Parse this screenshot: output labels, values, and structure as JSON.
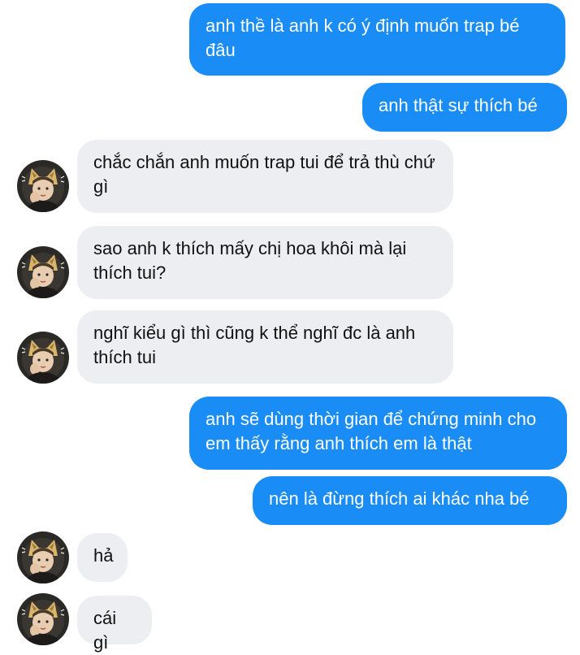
{
  "theme": {
    "outgoing_bubble": "#1a8cf5",
    "incoming_bubble": "#eceef1",
    "background": "#ffffff"
  },
  "avatar_icon": "user-photo-cat-ears-avatar",
  "messages": [
    {
      "sender": "me",
      "text": "anh thề là anh k có ý định muốn trap bé đâu"
    },
    {
      "sender": "me",
      "text": "anh thật sự thích bé"
    },
    {
      "sender": "them",
      "text": "chắc chắn anh muốn trap tui để trả thù chứ gì"
    },
    {
      "sender": "them",
      "text": "sao anh k thích mấy chị hoa khôi mà lại thích tui?"
    },
    {
      "sender": "them",
      "text": "nghĩ kiểu gì thì cũng k thể nghĩ đc là anh thích tui"
    },
    {
      "sender": "me",
      "text": "anh sẽ dùng thời gian để chứng minh cho em thấy rằng anh thích em là thật"
    },
    {
      "sender": "me",
      "text": "nên là đừng thích ai khác nha bé"
    },
    {
      "sender": "them",
      "text": "hả"
    },
    {
      "sender": "them",
      "text": "cái gì"
    }
  ]
}
